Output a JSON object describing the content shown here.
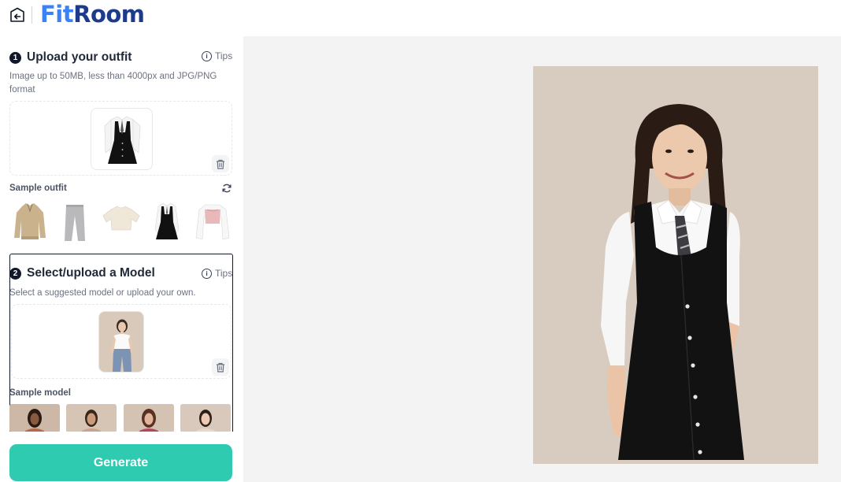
{
  "app": {
    "logo_part1": "Fit",
    "logo_part2": "Room"
  },
  "step1": {
    "number": "1",
    "title": "Upload your outfit",
    "tips_label": "Tips",
    "description": "Image up to 50MB, less than 4000px and JPG/PNG format",
    "sample_label": "Sample outfit",
    "samples": [
      "beige half-zip sweater",
      "grey trousers",
      "cream crop top",
      "black pinafore dress with white shirt",
      "pink corset top with white blouse"
    ]
  },
  "step2": {
    "number": "2",
    "title": "Select/upload a Model",
    "tips_label": "Tips",
    "description": "Select a suggested model or upload your own.",
    "sample_label": "Sample model"
  },
  "footer": {
    "generate_label": "Generate"
  },
  "colors": {
    "accent": "#2ecbb0",
    "logo_blue": "#3b82f6",
    "logo_navy": "#1e3a8a",
    "preview_bg": "#d8cbbf"
  },
  "icons": {
    "back": "back-arrow-icon",
    "info": "info-icon",
    "trash": "trash-icon",
    "refresh": "refresh-icon"
  }
}
